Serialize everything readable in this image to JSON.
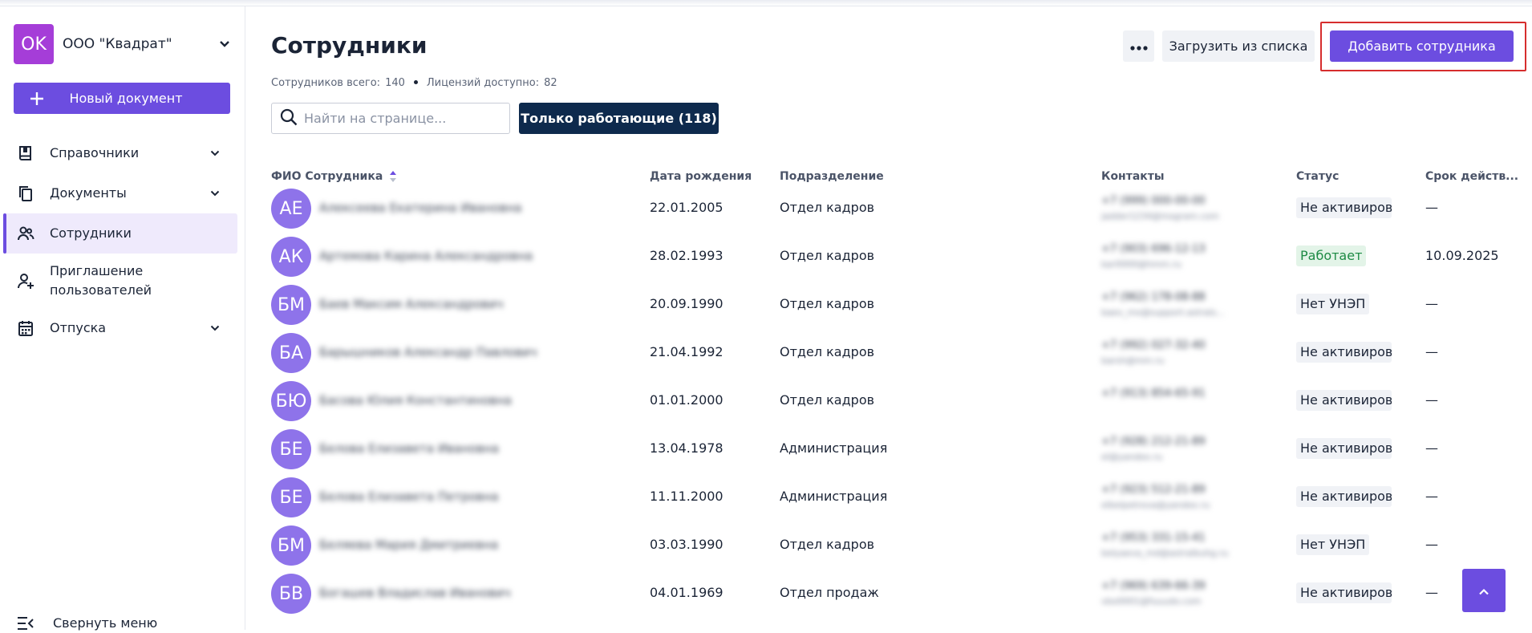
{
  "org": {
    "initials": "OK",
    "name": "ООО \"Квадрат\"",
    "logo_color": "#a53dd8"
  },
  "sidebar": {
    "new_document": "Новый документ",
    "items": [
      {
        "label": "Справочники",
        "icon": "book-icon",
        "has_submenu": true
      },
      {
        "label": "Документы",
        "icon": "documents-icon",
        "has_submenu": true
      },
      {
        "label": "Сотрудники",
        "icon": "users-icon",
        "has_submenu": false,
        "active": true
      },
      {
        "label": "Приглашение пользователей",
        "icon": "add-user-icon",
        "has_submenu": false
      },
      {
        "label": "Отпуска",
        "icon": "calendar-icon",
        "has_submenu": true
      }
    ],
    "collapse_label": "Свернуть меню"
  },
  "header": {
    "title": "Сотрудники",
    "stats": {
      "total_label": "Сотрудников всего:",
      "total_value": "140",
      "licenses_label": "Лицензий доступно:",
      "licenses_value": "82"
    },
    "upload_label": "Загрузить из списка",
    "add_label": "Добавить сотрудника"
  },
  "search": {
    "placeholder": "Найти на странице...",
    "value": ""
  },
  "filter_label": "Только работающие (118)",
  "table": {
    "columns": [
      "ФИО Сотрудника",
      "Дата рождения",
      "Подразделение",
      "Контакты",
      "Статус",
      "Срок действ..."
    ],
    "rows": [
      {
        "initials": "АЕ",
        "name": "Алексеева Екатерина Ивановна",
        "birth": "22.01.2005",
        "dept": "Отдел кадров",
        "phone": "+7 (999) 000-00-00",
        "email": "jadder1234@inogram.com",
        "status": "Не активирован",
        "status_kind": "neutral",
        "valid": "—"
      },
      {
        "initials": "АК",
        "name": "Артемова Карина Александровна",
        "birth": "28.02.1993",
        "dept": "Отдел кадров",
        "phone": "+7 (903) 696-12-13",
        "email": "kar0000@hmm.ru",
        "status": "Работает",
        "status_kind": "ok",
        "valid": "10.09.2025"
      },
      {
        "initials": "БМ",
        "name": "Баев Максим Александрович",
        "birth": "20.09.1990",
        "dept": "Отдел кадров",
        "phone": "+7 (962) 178-08-88",
        "email": "baev_mx@support.astrals...",
        "status": "Нет УНЭП",
        "status_kind": "neutral",
        "valid": "—"
      },
      {
        "initials": "БА",
        "name": "Барышников Александр Павлович",
        "birth": "21.04.1992",
        "dept": "Отдел кадров",
        "phone": "+7 (992) 027-32-40",
        "email": "barsh@mm.ru",
        "status": "Не активирован",
        "status_kind": "neutral",
        "valid": "—"
      },
      {
        "initials": "БЮ",
        "name": "Басова Юлия Константиновна",
        "birth": "01.01.2000",
        "dept": "Отдел кадров",
        "phone": "+7 (913) 854-65-91",
        "email": "",
        "status": "Не активирован",
        "status_kind": "neutral",
        "valid": "—"
      },
      {
        "initials": "БЕ",
        "name": "Белова Елизавета Ивановна",
        "birth": "13.04.1978",
        "dept": "Администрация",
        "phone": "+7 (928) 212-21-89",
        "email": "el@yandex.ru",
        "status": "Не активирован",
        "status_kind": "neutral",
        "valid": "—"
      },
      {
        "initials": "БЕ",
        "name": "Белова Елизавета Петровна",
        "birth": "11.11.2000",
        "dept": "Администрация",
        "phone": "+7 (923) 512-21-89",
        "email": "elbelpetrova@yandex.ru",
        "status": "Не активирован",
        "status_kind": "neutral",
        "valid": "—"
      },
      {
        "initials": "БМ",
        "name": "Беляева Мария Дмитриевна",
        "birth": "03.03.1990",
        "dept": "Отдел кадров",
        "phone": "+7 (953) 331-15-41",
        "email": "belyaeva_md@astralbuhg.ru",
        "status": "Нет УНЭП",
        "status_kind": "neutral",
        "valid": "—"
      },
      {
        "initials": "БВ",
        "name": "Богашев Владислав Иванович",
        "birth": "04.01.1969",
        "dept": "Отдел продаж",
        "phone": "+7 (969) 639-66-39",
        "email": "vbo0001@fuuudo.com",
        "status": "Не активирован",
        "status_kind": "neutral",
        "valid": "—"
      }
    ]
  },
  "colors": {
    "accent": "#6c4de0",
    "dark_button": "#0e2a4d",
    "avatar": "#8e73ea",
    "status_ok": "#1d8a44",
    "highlight_frame": "#d62d2d"
  },
  "scroll_top_icon": "chevron-up-icon"
}
